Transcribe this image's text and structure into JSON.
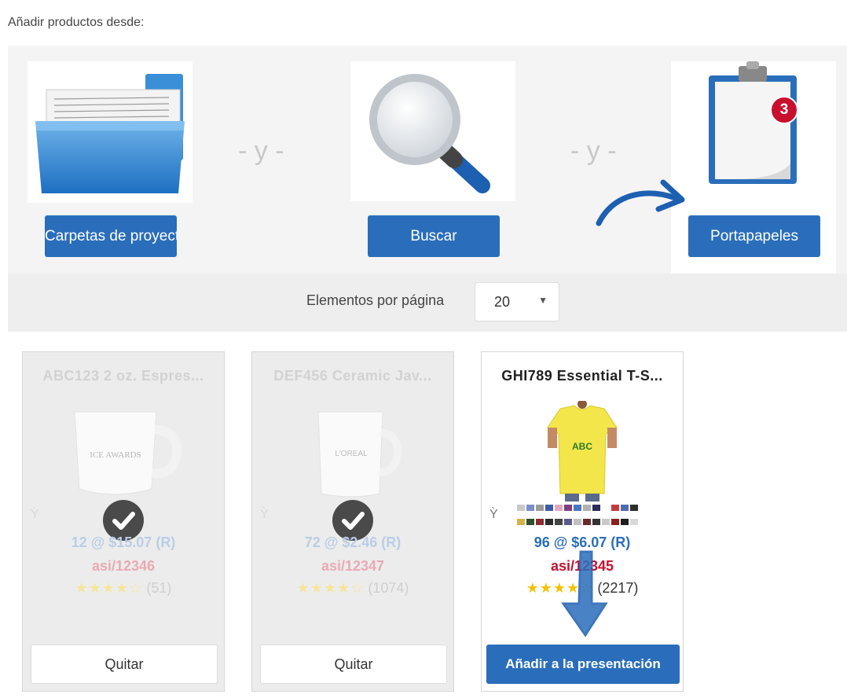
{
  "header": {
    "label": "Añadir productos desde:"
  },
  "sources": {
    "separator": "- y -",
    "folders_label": "Carpetas de proyectos",
    "search_label": "Buscar",
    "clipboard_label": "Portapapeles",
    "clipboard_badge": "3"
  },
  "perpage": {
    "label": "Elementos por página",
    "value": "20"
  },
  "products": [
    {
      "title": "ABC123 2 oz. Espres...",
      "price": "12 @ $15.07 (R)",
      "asi": "asi/12346",
      "stars": "★★★★☆",
      "reviews": "(51)",
      "action": "Quitar",
      "logo_text": "ICE AWARDS"
    },
    {
      "title": "DEF456 Ceramic Jav...",
      "price": "72 @ $2.46 (R)",
      "asi": "asi/12347",
      "stars": "★★★★☆",
      "reviews": "(1074)",
      "action": "Quitar",
      "logo_text": "L'OREAL"
    },
    {
      "title": "GHI789 Essential T-S...",
      "price": "96 @ $6.07 (R)",
      "asi": "asi/12345",
      "stars": "★★★★☆",
      "reviews": "(2217)",
      "action": "Añadir a la presentación",
      "logo_text": "ABC"
    }
  ],
  "colors": {
    "brand_blue": "#2a6ebb",
    "asi_red": "#c8102e",
    "star_gold": "#f2c200"
  }
}
